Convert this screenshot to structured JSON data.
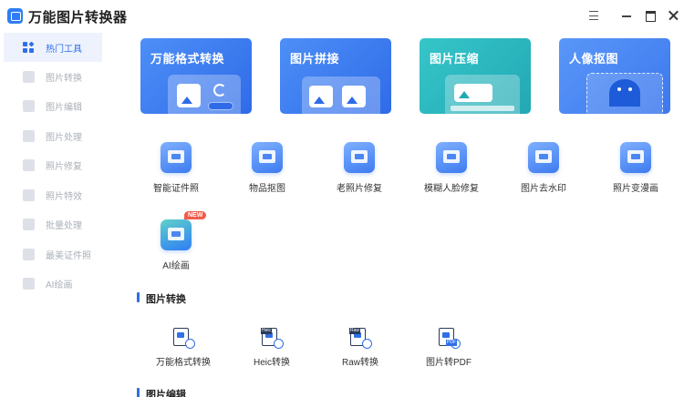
{
  "app": {
    "title": "万能图片转换器"
  },
  "sidebar": {
    "items": [
      {
        "label": "热门工具",
        "active": true
      },
      {
        "label": "图片转换"
      },
      {
        "label": "图片编辑"
      },
      {
        "label": "图片处理"
      },
      {
        "label": "照片修复"
      },
      {
        "label": "照片特效"
      },
      {
        "label": "批量处理"
      },
      {
        "label": "最美证件照"
      },
      {
        "label": "AI绘画"
      }
    ]
  },
  "banners": [
    {
      "title": "万能格式转换",
      "color": "#2f6be8"
    },
    {
      "title": "图片拼接",
      "color": "#2f6be8"
    },
    {
      "title": "图片压缩",
      "color": "#22a8b4"
    },
    {
      "title": "人像抠图",
      "color": "#3d78ee"
    }
  ],
  "tools": [
    {
      "label": "智能证件照",
      "icon": "id-card-icon"
    },
    {
      "label": "物品抠图",
      "icon": "cutout-icon"
    },
    {
      "label": "老照片修复",
      "icon": "wrench-icon"
    },
    {
      "label": "模糊人脸修复",
      "icon": "portrait-icon"
    },
    {
      "label": "图片去水印",
      "icon": "watermark-icon"
    },
    {
      "label": "照片变漫画",
      "icon": "cartoon-icon"
    },
    {
      "label": "AI绘画",
      "icon": "ai-paint-icon",
      "badge": "NEW"
    }
  ],
  "sections": {
    "convert": {
      "title": "图片转换",
      "items": [
        {
          "label": "万能格式转换",
          "tag": ""
        },
        {
          "label": "Heic转换",
          "tag": "Heic"
        },
        {
          "label": "Raw转换",
          "tag": "Raw"
        },
        {
          "label": "图片转PDF",
          "tag": "PDF"
        }
      ]
    },
    "edit": {
      "title": "图片编辑"
    }
  },
  "colors": {
    "accent": "#2f6fe8",
    "badge": "#f25b4b"
  }
}
